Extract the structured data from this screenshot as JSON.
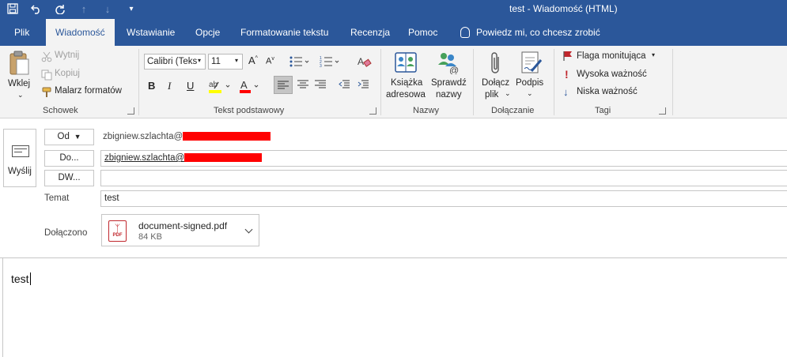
{
  "window": {
    "title": "test  -  Wiadomość (HTML)"
  },
  "quick_access": [
    "save-icon",
    "undo-icon",
    "redo-icon",
    "up-icon",
    "down-icon",
    "customize-icon"
  ],
  "tabs": [
    {
      "label": "Plik",
      "active": false
    },
    {
      "label": "Wiadomość",
      "active": true
    },
    {
      "label": "Wstawianie",
      "active": false
    },
    {
      "label": "Opcje",
      "active": false
    },
    {
      "label": "Formatowanie tekstu",
      "active": false
    },
    {
      "label": "Recenzja",
      "active": false
    },
    {
      "label": "Pomoc",
      "active": false
    }
  ],
  "tell_me": "Powiedz mi, co chcesz zrobić",
  "ribbon": {
    "clipboard": {
      "label": "Schowek",
      "paste": "Wklej",
      "cut": "Wytnij",
      "copy": "Kopiuj",
      "format_painter": "Malarz formatów"
    },
    "basic_text": {
      "label": "Tekst podstawowy",
      "font": "Calibri (Teks",
      "size": "11",
      "bold": "B",
      "italic": "I",
      "underline": "U"
    },
    "names": {
      "label": "Nazwy",
      "address_book_1": "Książka",
      "address_book_2": "adresowa",
      "check_names_1": "Sprawdź",
      "check_names_2": "nazwy"
    },
    "include": {
      "label": "Dołączanie",
      "attach_1": "Dołącz",
      "attach_2": "plik",
      "signature": "Podpis"
    },
    "tags": {
      "label": "Tagi",
      "follow_up": "Flaga monitująca",
      "high_importance": "Wysoka ważność",
      "low_importance": "Niska ważność"
    }
  },
  "message": {
    "send_label": "Wyślij",
    "from_button": "Od",
    "from_value": "zbigniew.szlachta@",
    "to_button": "Do...",
    "to_value": "zbigniew.szlachta@",
    "cc_button": "DW...",
    "cc_value": "",
    "subject_label": "Temat",
    "subject_value": "test",
    "attached_label": "Dołączono",
    "attachment_name": "document-signed.pdf",
    "attachment_size": "84 KB",
    "attachment_badge": "PDF",
    "body_text": "test"
  },
  "colors": {
    "accent": "#2b579a",
    "ribbon_bg": "#f3f3f3",
    "redaction": "#ff0000",
    "flag": "#c0272d",
    "high_importance": "#c0272d",
    "low_importance": "#2b579a"
  }
}
